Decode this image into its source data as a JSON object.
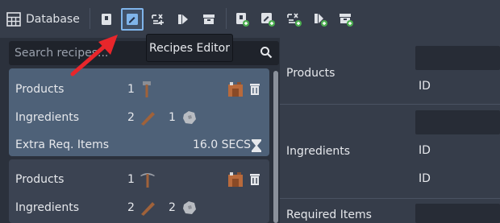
{
  "toolbar": {
    "database_label": "Database",
    "tooltip": "Recipes Editor"
  },
  "search": {
    "placeholder": "Search recipes..."
  },
  "recipes": [
    {
      "products_label": "Products",
      "products_count": "1",
      "ingredients_label": "Ingredients",
      "ingredient1_count": "2",
      "ingredient2_count": "1",
      "extra_label": "Extra Req. Items",
      "time": "16.0 SECS"
    },
    {
      "products_label": "Products",
      "products_count": "1",
      "ingredients_label": "Ingredients",
      "ingredient1_count": "2",
      "ingredient2_count": "2"
    }
  ],
  "editor": {
    "products_label": "Products",
    "products_id_label": "ID",
    "ingredients_label": "Ingredients",
    "ingredients_id_label_1": "ID",
    "ingredients_id_label_2": "ID",
    "required_items_label": "Required Items"
  },
  "colors": {
    "accent": "#7fb4ea",
    "selected_card": "#4e6178",
    "arrow": "#e8262b"
  }
}
